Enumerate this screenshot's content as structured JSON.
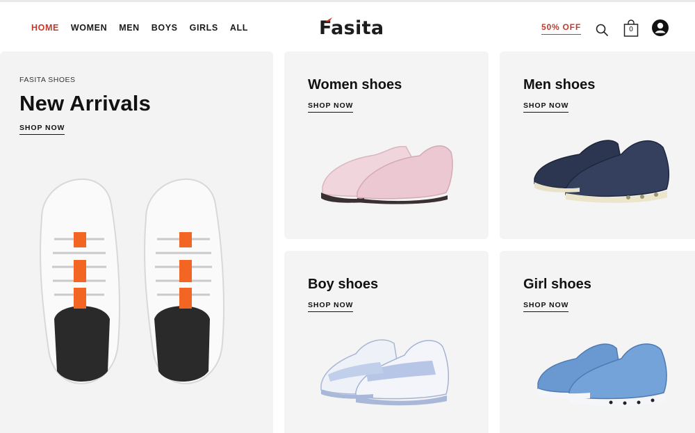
{
  "header": {
    "nav": [
      "HOME",
      "WOMEN",
      "MEN",
      "BOYS",
      "GIRLS",
      "ALL"
    ],
    "active_nav": "HOME",
    "logo": "Fasita",
    "offer": "50% OFF",
    "cart_count": "0",
    "icons": [
      "search-icon",
      "shopping-bag-icon",
      "user-account-icon"
    ]
  },
  "hero": {
    "eyebrow": "FASITA SHOES",
    "title": "New Arrivals",
    "cta": "SHOP NOW"
  },
  "categories": [
    {
      "title": "Women shoes",
      "cta": "SHOP NOW"
    },
    {
      "title": "Men shoes",
      "cta": "SHOP NOW"
    },
    {
      "title": "Boy shoes",
      "cta": "SHOP NOW"
    },
    {
      "title": "Girl shoes",
      "cta": "SHOP NOW"
    }
  ],
  "colors": {
    "accent": "#c0392b",
    "card_bg": "#f4f4f4",
    "text": "#111111"
  }
}
